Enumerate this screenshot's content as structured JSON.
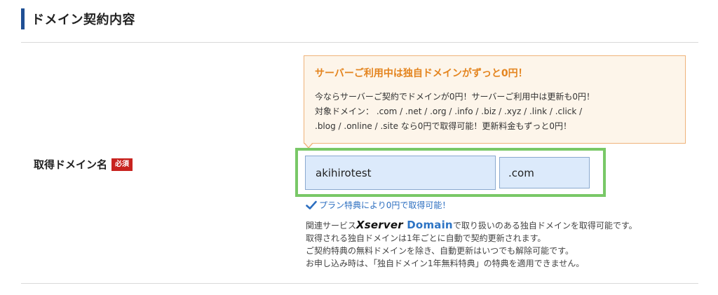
{
  "section": {
    "title": "ドメイン契約内容"
  },
  "field": {
    "label": "取得ドメイン名",
    "required_badge": "必須"
  },
  "promo": {
    "title": "サーバーご利用中は独自ドメインがずっと0円！",
    "lines": [
      "今ならサーバーご契約でドメインが0円！サーバーご利用中は更新も0円！",
      "対象ドメイン： .com / .net / .org / .info / .biz / .xyz / .link / .click /",
      ".blog / .online / .site なら0円で取得可能！更新料金もずっと0円！"
    ]
  },
  "domain_input": {
    "value": "akihirotest"
  },
  "tld_select": {
    "value": ".com"
  },
  "availability": {
    "text": "プラン特典により0円で取得可能！"
  },
  "notes": {
    "line1_before": "関連サービス",
    "brand_x": "Xserver",
    "brand_domain": "Domain",
    "line1_after": "で取り扱いのある独自ドメインを取得可能です。",
    "line2": "取得される独自ドメインは1年ごとに自動で契約更新されます。",
    "line3": "ご契約特典の無料ドメインを除き、自動更新はいつでも解除可能です。",
    "line4": "お申し込み時は、「独自ドメイン1年無料特典」の特典を適用できません。"
  },
  "colors": {
    "accent_bar": "#1f4f94",
    "promo_title": "#e4841e",
    "promo_border": "#efb37a",
    "input_highlight": "#79c867",
    "required_badge": "#c8231f",
    "link_blue": "#2d6fc0"
  },
  "icons": {
    "availability_icon": "check-icon"
  }
}
